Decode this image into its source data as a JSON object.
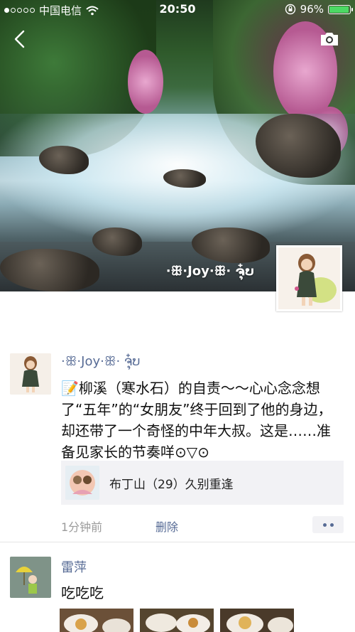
{
  "status_bar": {
    "carrier": "中国电信",
    "time": "20:50",
    "battery_percent": "96%",
    "signal_dots": 5,
    "signal_filled": 1,
    "battery_level": 0.96
  },
  "cover": {
    "user_name": "·ꕥ·Joy·ꕥ· ຈຸ໋ບ"
  },
  "post": {
    "author": "·ꕥ·Joy·ꕥ· ຈຸ໋ບ",
    "text": "📝柳溪（寒水石）的自责～～心心念念想了“五年”的“女朋友”终于回到了他的身边，却还带了一个奇怪的中年大叔。这是……准备见家长的节奏咩⊙▽⊙",
    "shared_title": "布丁山（29）久别重逢",
    "time": "1分钟前",
    "delete_label": "删除"
  },
  "comment_post": {
    "author": "雷萍",
    "text": "吃吃吃"
  },
  "icons": {
    "back": "chevron-left-icon",
    "camera": "camera-icon",
    "wifi": "wifi-icon",
    "lock": "orientation-lock-icon",
    "battery": "battery-icon",
    "more": "more-dots-icon"
  },
  "colors": {
    "link_blue": "#576b95",
    "meta_gray": "#9b9b9b",
    "card_bg": "#f2f2f5",
    "battery_green": "#4cd964"
  }
}
